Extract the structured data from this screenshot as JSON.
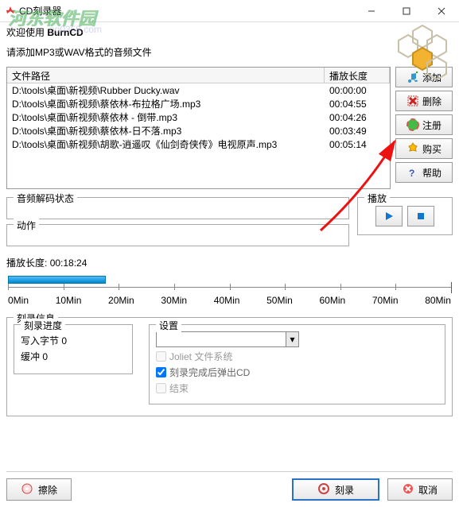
{
  "window": {
    "title": "CD刻录器"
  },
  "watermark": "河东软件园",
  "watermark_url": "no0359.com",
  "welcome_prefix": "欢迎使用 ",
  "welcome_app": "BurnCD",
  "hint": "请添加MP3或WAV格式的音频文件",
  "columns": {
    "path": "文件路径",
    "duration": "播放长度"
  },
  "files": [
    {
      "path": "D:\\tools\\桌面\\新视频\\Rubber Ducky.wav",
      "dur": "00:00:00"
    },
    {
      "path": "D:\\tools\\桌面\\新视频\\蔡依林-布拉格广场.mp3",
      "dur": "00:04:55"
    },
    {
      "path": "D:\\tools\\桌面\\新视频\\蔡依林 - 倒带.mp3",
      "dur": "00:04:26"
    },
    {
      "path": "D:\\tools\\桌面\\新视频\\蔡依林-日不落.mp3",
      "dur": "00:03:49"
    },
    {
      "path": "D:\\tools\\桌面\\新视频\\胡歌-逍遥叹《仙剑奇侠传》电视原声.mp3",
      "dur": "00:05:14"
    }
  ],
  "sidebar": {
    "add": "添加",
    "delete": "删除",
    "register": "注册",
    "buy": "购买",
    "help": "帮助"
  },
  "decode": {
    "status_label": "音频解码状态",
    "action_label": "动作",
    "action_value": ""
  },
  "play": {
    "label": "播放"
  },
  "playlen": {
    "label": "播放长度:",
    "value": "00:18:24"
  },
  "ticks": [
    "0Min",
    "10Min",
    "20Min",
    "30Min",
    "40Min",
    "50Min",
    "60Min",
    "70Min",
    "80Min"
  ],
  "burn": {
    "title": "刻录信息",
    "progress_title": "刻录进度",
    "write_bytes_label": "写入字节",
    "write_bytes_value": "0",
    "buffer_label": "缓冲",
    "buffer_value": "0",
    "settings_label": "设置",
    "chk_joliet": "Joliet 文件系统",
    "chk_eject": "刻录完成后弹出CD",
    "chk_finalize": "结束"
  },
  "footer": {
    "erase": "擦除",
    "burn": "刻录",
    "cancel": "取消"
  }
}
